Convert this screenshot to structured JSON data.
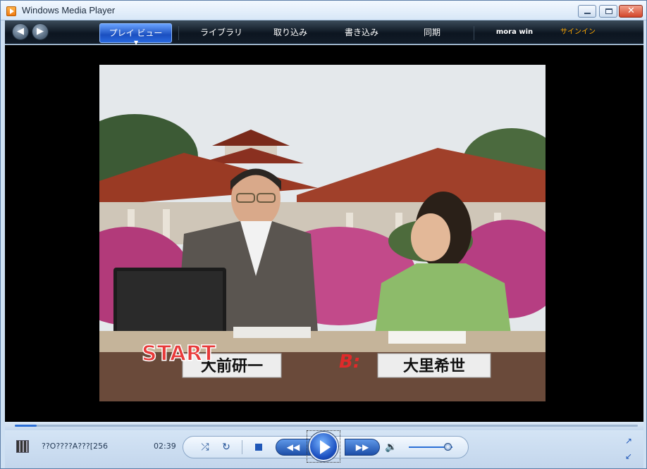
{
  "window": {
    "title": "Windows Media Player"
  },
  "nav": {
    "tabs": [
      "プレイ ビュー",
      "ライブラリ",
      "取り込み",
      "書き込み",
      "同期",
      "mora win",
      "サインイン"
    ]
  },
  "video": {
    "overlay_logo": "START",
    "brand_mark": "B:",
    "caption_left": "大前研一",
    "caption_right": "大里希世"
  },
  "player": {
    "track_title": "??O????A???[256",
    "elapsed_time": "02:39",
    "progress_fraction": 0.035,
    "volume_fraction": 0.9
  },
  "colors": {
    "accent": "#1a4fc0",
    "signin": "#ffa800",
    "start_logo": "#e83a3a"
  }
}
